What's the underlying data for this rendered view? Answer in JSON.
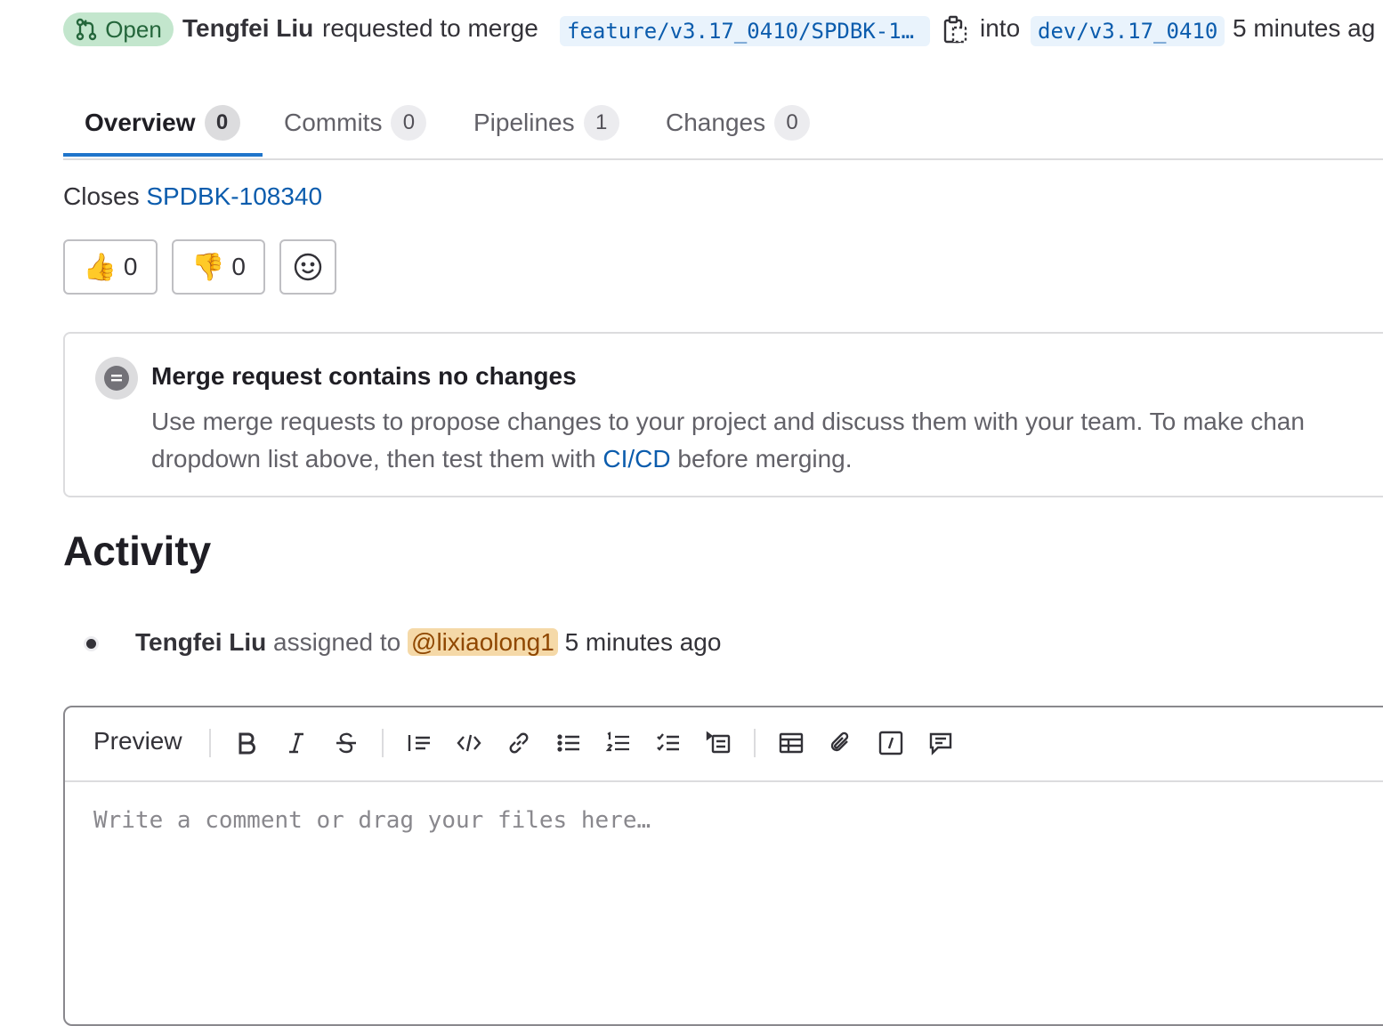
{
  "header": {
    "status": "Open",
    "author": "Tengfei Liu",
    "action_text": "requested to merge",
    "source_branch": "feature/v3.17_0410/SPDBK-1…",
    "into_text": "into",
    "target_branch": "dev/v3.17_0410",
    "time_text": "5 minutes ag",
    "status_color": "#c3e6cd"
  },
  "tabs": [
    {
      "label": "Overview",
      "count": "0"
    },
    {
      "label": "Commits",
      "count": "0"
    },
    {
      "label": "Pipelines",
      "count": "1"
    },
    {
      "label": "Changes",
      "count": "0"
    }
  ],
  "description": {
    "closes_text": "Closes",
    "issue_link": "SPDBK-108340"
  },
  "reactions": {
    "thumbs_up_count": "0",
    "thumbs_down_count": "0"
  },
  "info_box": {
    "title": "Merge request contains no changes",
    "text_before_link": "Use merge requests to propose changes to your project and discuss them with your team. To make chan",
    "text_line2_start": "dropdown list above, then test them with",
    "link_text": "CI/CD",
    "text_after_link": "before merging."
  },
  "activity": {
    "title": "Activity",
    "items": [
      {
        "author": "Tengfei Liu",
        "action": "assigned to",
        "mention": "@lixiaolong1",
        "time": "5 minutes ago"
      }
    ]
  },
  "editor": {
    "preview_label": "Preview",
    "placeholder": "Write a comment or drag your files here…"
  },
  "colors": {
    "link": "#0b5cad",
    "active_tab_underline": "#1f75cb",
    "mention_bg": "#f5d9a8"
  }
}
